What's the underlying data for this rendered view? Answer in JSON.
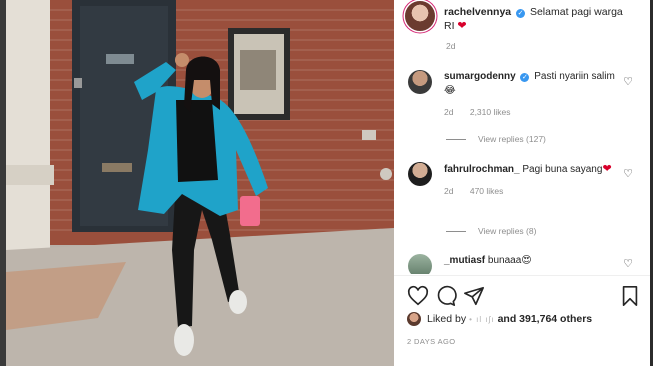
{
  "post": {
    "caption_user": "rachelvennya",
    "caption_text": "Selamat pagi warga RI",
    "caption_time": "2d"
  },
  "comments": [
    {
      "user": "sumargodenny",
      "text": "Pasti nyariin salim",
      "emoji": "😂",
      "time": "2d",
      "likes": "2,310 likes",
      "replies": "View replies (127)"
    },
    {
      "user": "fahrulrochman_",
      "text": "Pagi buna sayang",
      "emoji": "❤",
      "time": "2d",
      "likes": "470 likes",
      "replies": "View replies (8)"
    },
    {
      "user": "_mutiasf",
      "text": "bunaaa",
      "emoji": "😍"
    }
  ],
  "likes": {
    "prefix": "Liked by",
    "blurred": "• ıl ıʃı",
    "count_text": "and 391,764 others"
  },
  "post_date": "2 DAYS AGO",
  "icons": {
    "like": "heart-outline-icon",
    "comment": "comment-bubble-icon",
    "share": "paper-plane-icon",
    "save": "bookmark-icon",
    "verified": "verified-badge-icon"
  },
  "colors": {
    "verified": "#3897f0",
    "heart": "#d8002b",
    "muted_text": "#8e8e8e",
    "jacket": "#1fa3c9"
  }
}
